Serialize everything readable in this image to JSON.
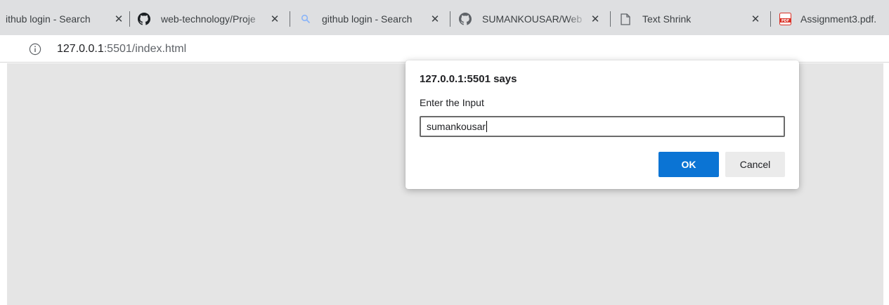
{
  "browser": {
    "tabs": [
      {
        "title": "ithub login - Search",
        "icon": "bing-search-icon"
      },
      {
        "title": "web-technology/Proje",
        "icon": "github-icon"
      },
      {
        "title": "github login - Search",
        "icon": "search-icon"
      },
      {
        "title": "SUMANKOUSAR/Web",
        "icon": "github-icon"
      },
      {
        "title": "Text Shrink",
        "icon": "document-icon"
      },
      {
        "title": "Assignment3.pdf.",
        "icon": "pdf-icon"
      }
    ],
    "close_glyph": "✕",
    "address_bar": {
      "host": "127.0.0.1",
      "rest": ":5501/index.html"
    }
  },
  "dialog": {
    "title": "127.0.0.1:5501 says",
    "message": "Enter the Input",
    "input_value": "sumankousar",
    "ok_label": "OK",
    "cancel_label": "Cancel"
  },
  "colors": {
    "tabstrip": "#dedfe1",
    "page_background": "#e5e5e5",
    "ok_button": "#0b74d4",
    "cancel_button": "#ebebeb",
    "pdf_icon": "#d93025",
    "github_icon": "#1b1f23"
  }
}
